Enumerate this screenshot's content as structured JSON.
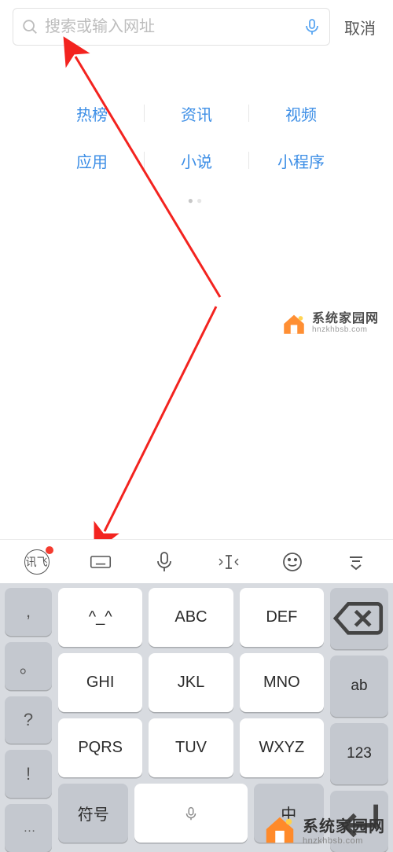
{
  "search": {
    "placeholder": "搜索或输入网址",
    "cancel": "取消"
  },
  "categories": {
    "row1": [
      "热榜",
      "资讯",
      "视频"
    ],
    "row2": [
      "应用",
      "小说",
      "小程序"
    ]
  },
  "watermark": {
    "title": "系统家园网",
    "sub": "hnzkhbsb.com"
  },
  "ime_toolbar": {
    "brand": "讯飞"
  },
  "keyboard": {
    "left": [
      ",",
      "。",
      "?",
      "!",
      "…"
    ],
    "main": [
      [
        "^_^",
        "ABC",
        "DEF"
      ],
      [
        "GHI",
        "JKL",
        "MNO"
      ],
      [
        "PQRS",
        "TUV",
        "WXYZ"
      ]
    ],
    "bottom": {
      "symbol": "符号",
      "lang": "中"
    },
    "right": {
      "backspace": "⌫",
      "ab": "ab",
      "num": "123",
      "enter": "↵"
    }
  }
}
